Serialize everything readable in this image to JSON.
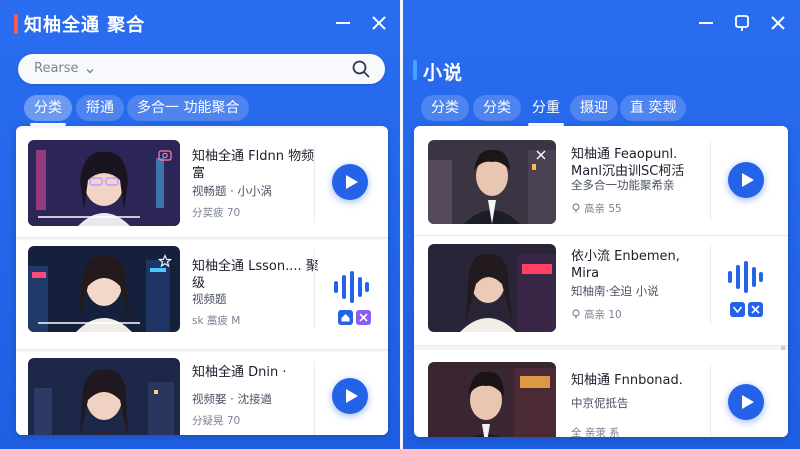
{
  "left_window": {
    "title": "知柚全通 聚合",
    "search": {
      "value": "Rearse"
    },
    "tabs": [
      "分类",
      "搿通",
      "多合一 功能聚合"
    ],
    "cards": [
      {
        "title": "知柚全通 Fldnn 物频富",
        "subtitle": "视畅题 · 小小涡",
        "meta": "分荬疲 70",
        "action": "play"
      },
      {
        "title": "知柚全通 Lsson.... 聚级",
        "subtitle": "视频题",
        "meta": "sk 藁疲 M",
        "action": "audio"
      },
      {
        "title": "知柚全通 Dnin ·",
        "subtitle": "视频娶 · 沈接遒",
        "meta": "分疑晃 70",
        "action": "play"
      }
    ]
  },
  "right_window": {
    "title": "小说",
    "tabs": [
      "分类",
      "分类",
      "分重",
      "摄迎",
      "直 奕觌"
    ],
    "cards": [
      {
        "title": "知柚通 Feaopunl. Manl沉由训SC柯活",
        "subtitle": "全多合一功能聚希亲",
        "meta": "高亲 55",
        "action": "play"
      },
      {
        "title": "依小流 Enbemen, Mira",
        "subtitle": "知柚南·全迫 小说",
        "meta": "高亲 10",
        "action": "audio"
      },
      {
        "title": "知柚通 Fnnbonad.",
        "subtitle": "中京伲抵告",
        "meta": "全 亲莍 系",
        "action": "play"
      }
    ]
  },
  "colors": {
    "background": "#1f5fe0",
    "accent": "#2463e8",
    "title_marker": "#ff5a4a"
  },
  "icons": {
    "left_window_controls": [
      "minimize-icon",
      "close-icon"
    ],
    "right_window_controls": [
      "minimize-icon",
      "pin-icon",
      "close-icon"
    ],
    "search": "search-icon",
    "play": "play-icon",
    "audio": "audio-wave-icon"
  }
}
